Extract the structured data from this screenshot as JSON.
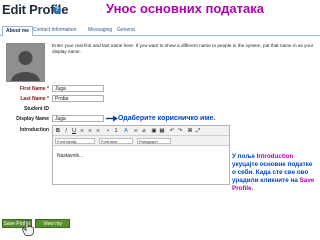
{
  "header": {
    "title": "Edit Profile",
    "banner": "Унос основних података"
  },
  "tabs": [
    {
      "label": "About me"
    },
    {
      "label": "Contact information"
    },
    {
      "label": "Messaging"
    },
    {
      "label": "General"
    }
  ],
  "intro": {
    "text": "Enter your real first and last name here. If you want to show a different name to people in the system, put that name in as your display name."
  },
  "form": {
    "first_name_label": "First Name *",
    "first_name_value": "Juga",
    "last_name_label": "Last Name *",
    "last_name_value": "Proba",
    "student_id_label": "Student ID",
    "display_name_label": "Display Name",
    "display_name_value": "Juga",
    "introduction_label": "Introduction"
  },
  "annotations": {
    "display_hint": "Одаберите корисничко име.",
    "side_note_prefix": "У пољe ",
    "side_note_intro": "Introduction",
    "side_note_mid": " укуцајте основне податке о себи. Када сте све ово урадили кликните на ",
    "side_note_save": "Save Profile",
    "side_note_end": "."
  },
  "editor": {
    "font_family": "Font family",
    "font_size": "Font size",
    "format": "Paragraph",
    "content": "Nastavnik..."
  },
  "buttons": {
    "save": "Save Profile",
    "view": "View my profile"
  },
  "colors": {
    "banner": "#b000b0",
    "hint": "#0044cc",
    "button": "#5a8f2d"
  }
}
